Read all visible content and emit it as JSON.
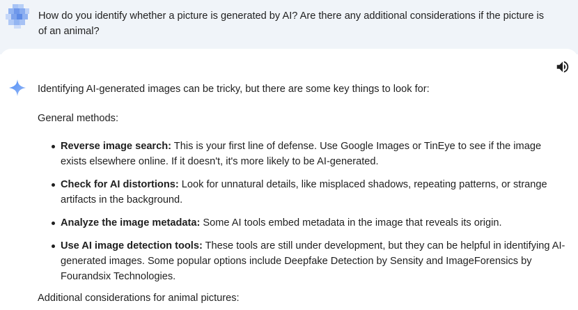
{
  "prompt": {
    "text": "How do you identify whether a picture is generated by AI? Are there any additional considerations if the picture is of an animal?"
  },
  "toolbar": {
    "icons": [
      "speaker-icon"
    ]
  },
  "response": {
    "icon": "sparkle-icon",
    "intro": "Identifying AI-generated images can be tricky, but there are some key things to look for:",
    "general_heading": "General methods:",
    "methods": [
      {
        "title": "Reverse image search:",
        "text": " This is your first line of defense. Use Google Images or TinEye to see if the image exists elsewhere online. If it doesn't, it's more likely to be AI-generated."
      },
      {
        "title": "Check for AI distortions:",
        "text": " Look for unnatural details, like misplaced shadows, repeating patterns, or strange artifacts in the background."
      },
      {
        "title": "Analyze the image metadata:",
        "text": " Some AI tools embed metadata in the image that reveals its origin."
      },
      {
        "title": "Use AI image detection tools:",
        "text": " These tools are still under development, but they can be helpful in identifying AI-generated images. Some popular options include Deepfake Detection by Sensity and ImageForensics by Fourandsix Technologies."
      }
    ],
    "animal_heading": "Additional considerations for animal pictures:"
  },
  "colors": {
    "prompt_bg": "#f0f4f9",
    "text": "#1f1f1f",
    "avatar_blue": "#8ab4f8",
    "sparkle_blue": "#4b8df8"
  }
}
